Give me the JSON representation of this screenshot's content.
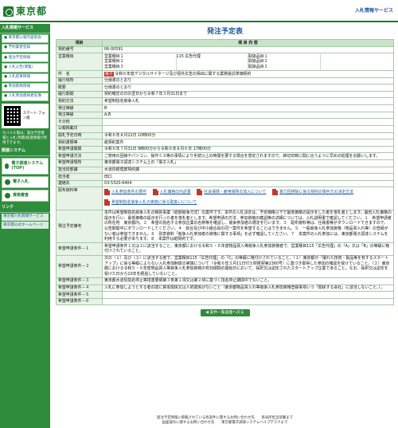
{
  "header": {
    "logo_text": "東京都",
    "service_name": "入札情報サービス"
  },
  "sidebar": {
    "section1": "入札情報サービス",
    "items1": [
      "東京都公報内容照会",
      "予約業者登録",
      "発注予定情報",
      "入札公告(閲覧)",
      "入札結果情報",
      "参加資格情報",
      "入札参加資格者名簿"
    ],
    "qr_label": "スマート フォン版",
    "mobile_text": "モバイル版は、発注予定情報と入札(見積)経過情報が利用できます。",
    "section2": "関連システム",
    "buttons": [
      "電子調達システム(TOP)",
      "電子入札",
      "資格審査"
    ],
    "section3": "リンク",
    "links": [
      "東京都入札情報サービス",
      "東京都公式ホームページ"
    ]
  },
  "page": {
    "title": "発注予定表",
    "col_item": "項目",
    "col_content": "項 目 内 容"
  },
  "rows": {
    "contract_no": {
      "label": "契約番号",
      "value": "06-00591"
    },
    "sales_items": {
      "label": "営業種目",
      "lines": [
        {
          "a": "営業種目１",
          "b": "115 広告代理",
          "c": "取扱品目１",
          "d": ""
        },
        {
          "a": "営業種目２",
          "b": "",
          "c": "取扱品目２",
          "d": ""
        },
        {
          "a": "営業種目３",
          "b": "",
          "c": "取扱品目３",
          "d": ""
        }
      ]
    },
    "name": {
      "label": "件　名",
      "badge": "電子",
      "value": "令和６年度デジタルサイネージ及び屋外広告の掲出に関する業務委託単価契約"
    },
    "place": {
      "label": "履行場所",
      "value": "仕様書のとおり"
    },
    "summary": {
      "label": "概要",
      "value": "仕様書のとおり"
    },
    "period": {
      "label": "履行期間",
      "value": "契約確定の日の翌日から令和７年３月31日まで"
    },
    "method": {
      "label": "契約方法",
      "value": "希望制指名競争入札"
    },
    "dept": {
      "label": "発注等級",
      "value": "B"
    },
    "grade": {
      "label": "発注等級",
      "value": "A,B"
    },
    "other": {
      "label": "その他",
      "value": ""
    },
    "announce": {
      "label": "公報掲載日",
      "value": ""
    },
    "open_date": {
      "label": "開札予定日時",
      "value": "令和６年８月22日 10時00分"
    },
    "doc_method": {
      "label": "契約書類等",
      "value": "紙契約案件"
    },
    "apply_period": {
      "label": "希望申請期間",
      "value": "令和６年７月31日 9時00分から令和６年８月６日 17時00分"
    },
    "apply_method": {
      "label": "希望申請方法",
      "value": "ご使用の回線やパソコン、操作ミス等の事情により手続以上の時間を要する場合を想定されますので、締切日時に間に合うように早めの処理をお願いします。"
    },
    "apply_dest": {
      "label": "希望申請場所",
      "value": "東京都電子調達システム上の「電子入札」"
    },
    "office": {
      "label": "担当局部課",
      "value": "水道局経理部契約課"
    },
    "person": {
      "label": "担当者",
      "value": "田口"
    },
    "phone": {
      "label": "連絡先",
      "value": "03-5320-6404"
    },
    "attachments": {
      "label": "配布資料等",
      "files": [
        "入札参加条件の要件",
        "入札価格の内訳書",
        "社会保険・雇用保険の加入について",
        "暴力団排除に係る契約の相手方の決定方法",
        "希望制指名競争入札の実施に係る取扱いについて"
      ]
    },
    "schedule": {
      "label": "発注予定備考",
      "value": "本件は希望制指名競争入札の種別事業（総額競争方式）の案件です。本件の入札決定は、予定価格以下で最低価格の提示をした者を落札者とします。最低入札価格の提示を行い、最低価格の提示を行った者を落札者とします。希望申請の方法、参加資格の確認等の詳細については、入札説明書で確認してください。１　希望申請者の所在地　東京都内。２　希望の指名する参加企業の名称等を確認し、競争参加者の選定を行います。３　配布資料等は、仕様書等がダウンロードできますので、公告期間中にダウンロードしてください。４　総合及び中小組合員の同一案件を希望することはできません。５　一般競争入札参加資格（物品買入れ等）の登録がない者は参加できません。６　別表資料「競争入札参加者の資格に関する事項」を必ず確認してください。７　本案件の入札参加には、東京都電子調達システムを利用する必要があります。８　本案件は紙契約です。"
    },
    "req1": {
      "label": "希望申請条件－１",
      "value": "希望申請条件１又は２に該当すること。東京都における令和５・６年度物品買入等競争入札参加資格者で、営業種目115「広告代理」の「A」又は「B」の等級に格付けされていること。"
    },
    "req2": {
      "label": "希望申請条件－２",
      "value": "次の（１）及び（２）に該当する者で、営業種目115「広告代理」の「C」の等級に格付けされていること。（１）東京都が「優れた技術・製品等を有するスタートアップ」に係る等級によらない入札参加制度の実施について（令和６年３月11日付５財経契第2360号）に基づき取得した参加の確認を受けていること。（２）東京都における令和５・６年度物品買入等競争入札参加資格の有効期間の開始日において、採択又は認定されたスタートアップ企業であること。なお、採択又は認定を受けた日から10年を経過していないこと。"
    },
    "req3": {
      "label": "希望申請条件－３",
      "value": "東京都水道局指名停止等措置要綱第３条第１項又は第２項に基づく指名停止期間中でないこと。"
    },
    "req4": {
      "label": "希望申請条件－４",
      "value": "入札に参加しようとする者の間に資本関係又は人的関係がないこと（東京都物品買入れ等競争入札参加資格登録事項いう「関係する会社」に該当しないこと。）。"
    },
    "req5": {
      "label": "希望申請条件－５",
      "value": ""
    },
    "req6": {
      "label": "希望申請条件－６",
      "value": ""
    }
  },
  "back_button": "◀ 案件一覧画面へ戻る",
  "footer": {
    "line1": "発注予定情報に掲載されている各案件に関するお問い合わせ先　　各局所担当部署まで",
    "line2": "画面操作に関するお問い合わせ先　　東京都電子調達システムヘルプデスクまで"
  }
}
